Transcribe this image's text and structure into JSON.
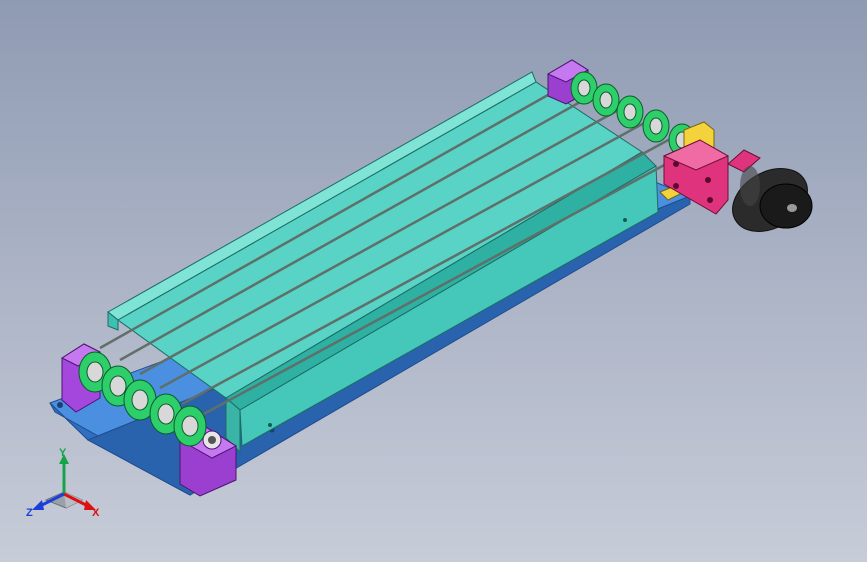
{
  "viewport": {
    "background_top": "#8f9bb3",
    "background_bottom": "#c7ccd8"
  },
  "model": {
    "colors": {
      "base_plate": "#3f86d8",
      "channel": "#55d6c8",
      "channel_shade": "#35a89c",
      "pulley": "#22c55e",
      "bearing_block": "#9b3fd1",
      "motor_mount": "#e0337e",
      "motor": "#2b2b2b",
      "bracket": "#f4d23c"
    }
  },
  "triad": {
    "axis_y": "Y",
    "axis_z": "Z",
    "axis_x": "X"
  }
}
